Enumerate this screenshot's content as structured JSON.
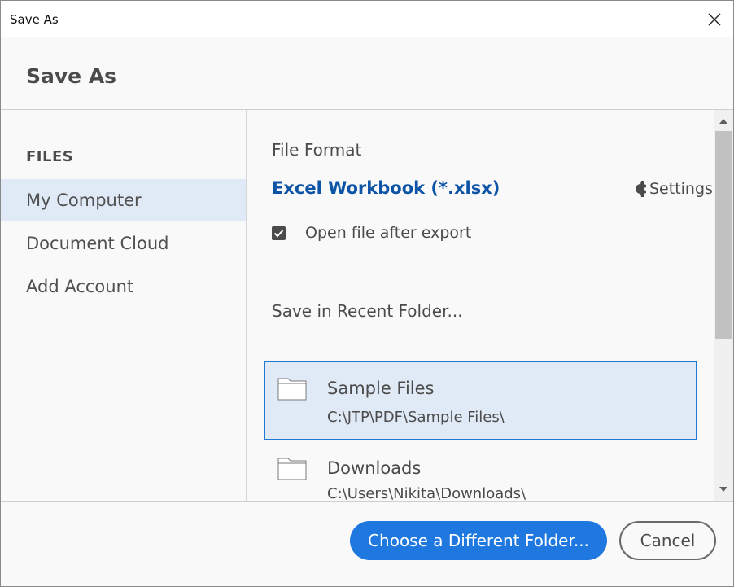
{
  "window": {
    "title": "Save As"
  },
  "header": {
    "title": "Save As"
  },
  "sidebar": {
    "section_title": "FILES",
    "items": [
      {
        "label": "My Computer",
        "selected": true
      },
      {
        "label": "Document Cloud",
        "selected": false
      },
      {
        "label": "Add Account",
        "selected": false
      }
    ]
  },
  "content": {
    "file_format_label": "File Format",
    "file_format_value": "Excel Workbook (*.xlsx)",
    "settings_label": "Settings",
    "open_after_export": {
      "label": "Open file after export",
      "checked": true
    },
    "recent_folder_label": "Save in Recent Folder...",
    "recent_folders": [
      {
        "name": "Sample Files",
        "path": "C:\\JTP\\PDF\\Sample Files\\",
        "selected": true
      },
      {
        "name": "Downloads",
        "path": "C:\\Users\\Nikita\\Downloads\\",
        "selected": false
      }
    ]
  },
  "footer": {
    "choose_folder_label": "Choose a Different Folder...",
    "cancel_label": "Cancel"
  },
  "colors": {
    "accent": "#1f78e0",
    "link_blue": "#0d53a6",
    "selection_bg": "#e0eaf6",
    "selection_border": "#1f78d1"
  },
  "icons": {
    "close": "close-icon",
    "settings": "gear-icon",
    "folder": "folder-icon",
    "checkbox": "checkmark-icon",
    "scroll_up": "chevron-up-icon",
    "scroll_down": "chevron-down-icon"
  }
}
